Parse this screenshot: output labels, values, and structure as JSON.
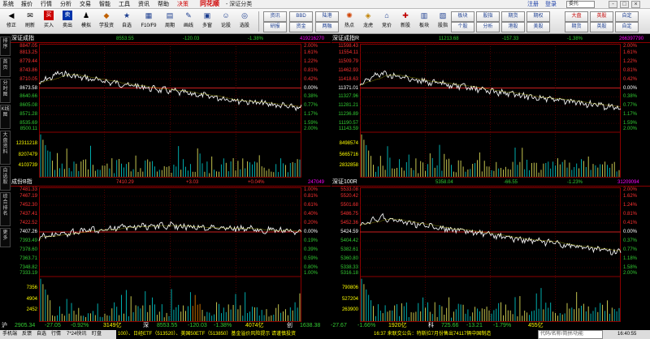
{
  "menu": {
    "items": [
      "系统",
      "报价",
      "行情",
      "分析",
      "交易",
      "智能",
      "工具",
      "资讯",
      "帮助"
    ],
    "decide": "决策",
    "logo": "同花顺",
    "window_title": "- 深证分类",
    "links": [
      "注册",
      "登录"
    ],
    "search_value": "委托",
    "window_buttons": [
      "-",
      "□",
      "×"
    ]
  },
  "toolbar": {
    "buttons": [
      {
        "label": "修正",
        "icon": "◀",
        "color": "#1a3c8f"
      },
      {
        "label": "刷新",
        "icon": "✉",
        "color": "#c08000"
      },
      {
        "label": "买入",
        "icon": "买",
        "color": "#cc0000"
      },
      {
        "label": "卖出",
        "icon": "卖",
        "color": "#0033aa"
      },
      {
        "label": "模拟",
        "icon": "♟",
        "color": "#6a3"
      },
      {
        "label": "学投资",
        "icon": "◆",
        "color": "#c06000"
      },
      {
        "label": "自选",
        "icon": "★",
        "color": "#1a3c8f"
      },
      {
        "label": "F10/F9",
        "icon": "▦",
        "color": "#1a3c8f"
      },
      {
        "label": "周期",
        "icon": "▤",
        "color": "#1a3c8f"
      },
      {
        "label": "画线",
        "icon": "✎",
        "color": "#1a3c8f"
      },
      {
        "label": "多窗",
        "icon": "▣",
        "color": "#1a3c8f"
      },
      {
        "label": "论股",
        "icon": "☺",
        "color": "#1a3c8f"
      },
      {
        "label": "选股",
        "icon": "◎",
        "color": "#1a3c8f"
      }
    ],
    "small_buttons": [
      "资讯",
      "BBD",
      "陆港",
      "研报",
      "资金",
      "两融",
      "热点",
      "龙虎",
      "竞价",
      "新股",
      "板块",
      "股指",
      "股指",
      "期货",
      "分析",
      "个股",
      "个股",
      "港股",
      "期权",
      "期货",
      "美股",
      "大盘",
      "英股",
      "自定"
    ]
  },
  "sidebar": {
    "tabs": [
      "排序",
      "首页",
      "分时图",
      "K线图",
      "大盘资料",
      "自选股",
      "综合排名",
      "更多"
    ]
  },
  "panels": [
    {
      "name": "深证成指",
      "price": "8553.55",
      "change": "-120.03",
      "pct": "-1.38%",
      "volume": "419216270",
      "price_levels": [
        "8847.05",
        "8813.25",
        "8779.44",
        "8743.86",
        "8710.05",
        "8673.58",
        "8640.66",
        "8605.08",
        "8571.28",
        "8535.69",
        "8500.11"
      ],
      "pct_levels": [
        "2.00%",
        "1.61%",
        "1.22%",
        "0.81%",
        "0.42%",
        "0.00%",
        "0.38%",
        "0.77%",
        "1.17%",
        "1.59%",
        "2.00%"
      ],
      "vol_levels": [
        "12311218",
        "8207479",
        "4103739"
      ],
      "ref_index": 5
    },
    {
      "name": "深证成指R",
      "price": "11213.68",
      "change": "-157.33",
      "pct": "-1.38%",
      "volume": "266397790",
      "price_levels": [
        "11598.43",
        "11554.11",
        "11509.79",
        "11462.93",
        "11418.63",
        "11371.01",
        "11327.96",
        "11281.21",
        "11236.89",
        "11190.57",
        "11143.59"
      ],
      "pct_levels": [
        "2.00%",
        "1.61%",
        "1.22%",
        "0.81%",
        "0.42%",
        "0.00%",
        "0.38%",
        "0.77%",
        "1.17%",
        "1.59%",
        "2.00%"
      ],
      "vol_levels": [
        "8498574",
        "5665716",
        "2832858"
      ],
      "ref_index": 5
    },
    {
      "name": "成份B指",
      "price": "7410.29",
      "change": "+3.03",
      "pct": "+0.04%",
      "volume": "247049",
      "price_levels": [
        "7481.33",
        "7467.19",
        "7452.30",
        "7437.41",
        "7422.52",
        "7407.26",
        "7393.49",
        "7378.60",
        "7363.71",
        "7348.82",
        "7333.19"
      ],
      "pct_levels": [
        "1.00%",
        "0.81%",
        "0.61%",
        "0.40%",
        "0.20%",
        "0.00%",
        "0.19%",
        "0.39%",
        "0.59%",
        "0.80%",
        "1.00%"
      ],
      "vol_levels": [
        "7356",
        "4904",
        "2452"
      ],
      "ref_index": 5
    },
    {
      "name": "深证100R",
      "price": "5358.04",
      "change": "-66.55",
      "pct": "-1.23%",
      "volume": "31209094",
      "price_levels": [
        "5533.08",
        "5520.42",
        "5501.68",
        "5486.75",
        "5452.36",
        "5424.59",
        "5404.42",
        "5382.61",
        "5360.80",
        "5338.33",
        "5316.18"
      ],
      "pct_levels": [
        "2.00%",
        "1.62%",
        "1.24%",
        "0.81%",
        "0.41%",
        "0.00%",
        "0.37%",
        "0.77%",
        "1.18%",
        "1.58%",
        "2.00%"
      ],
      "vol_levels": [
        "790806",
        "527204",
        "263900"
      ],
      "ref_index": 5
    }
  ],
  "summary": {
    "items": [
      {
        "text": "沪",
        "color": "#ffffff"
      },
      {
        "text": "2905.34",
        "color": "#33cc33"
      },
      {
        "text": "-27.05",
        "color": "#33cc33"
      },
      {
        "text": "-0.92%",
        "color": "#33cc33"
      },
      {
        "text": "3149亿",
        "color": "#ffff00"
      },
      {
        "text": "深",
        "color": "#ffffff"
      },
      {
        "text": "8553.55",
        "color": "#33cc33"
      },
      {
        "text": "-120.03",
        "color": "#33cc33"
      },
      {
        "text": "-1.38%",
        "color": "#33cc33"
      },
      {
        "text": "4074亿",
        "color": "#ffff00"
      },
      {
        "text": "创",
        "color": "#ffffff"
      },
      {
        "text": "1638.38",
        "color": "#33cc33"
      },
      {
        "text": "-27.67",
        "color": "#33cc33"
      },
      {
        "text": "-1.66%",
        "color": "#33cc33"
      },
      {
        "text": "1920亿",
        "color": "#ffff00"
      },
      {
        "text": "科",
        "color": "#ffffff"
      },
      {
        "text": "725.66",
        "color": "#33cc33"
      },
      {
        "text": "-13.21",
        "color": "#33cc33"
      },
      {
        "text": "-1.79%",
        "color": "#33cc33"
      },
      {
        "text": "455亿",
        "color": "#ffff00"
      }
    ]
  },
  "statusbar": {
    "items": [
      "手机端",
      "反馈",
      "自选",
      "行情",
      "7*24快讯",
      "盯盘"
    ],
    "ticker": "100）、日经ETF（513520）、美国50ETF（513850）基金溢价风险提示 请谨慎投资",
    "alert": "16:37 来联交公告：特斯拉7月份售出74117辆中国制造",
    "search_placeholder": "代码/名称/简拼/功能",
    "clock": "16:40:55"
  }
}
